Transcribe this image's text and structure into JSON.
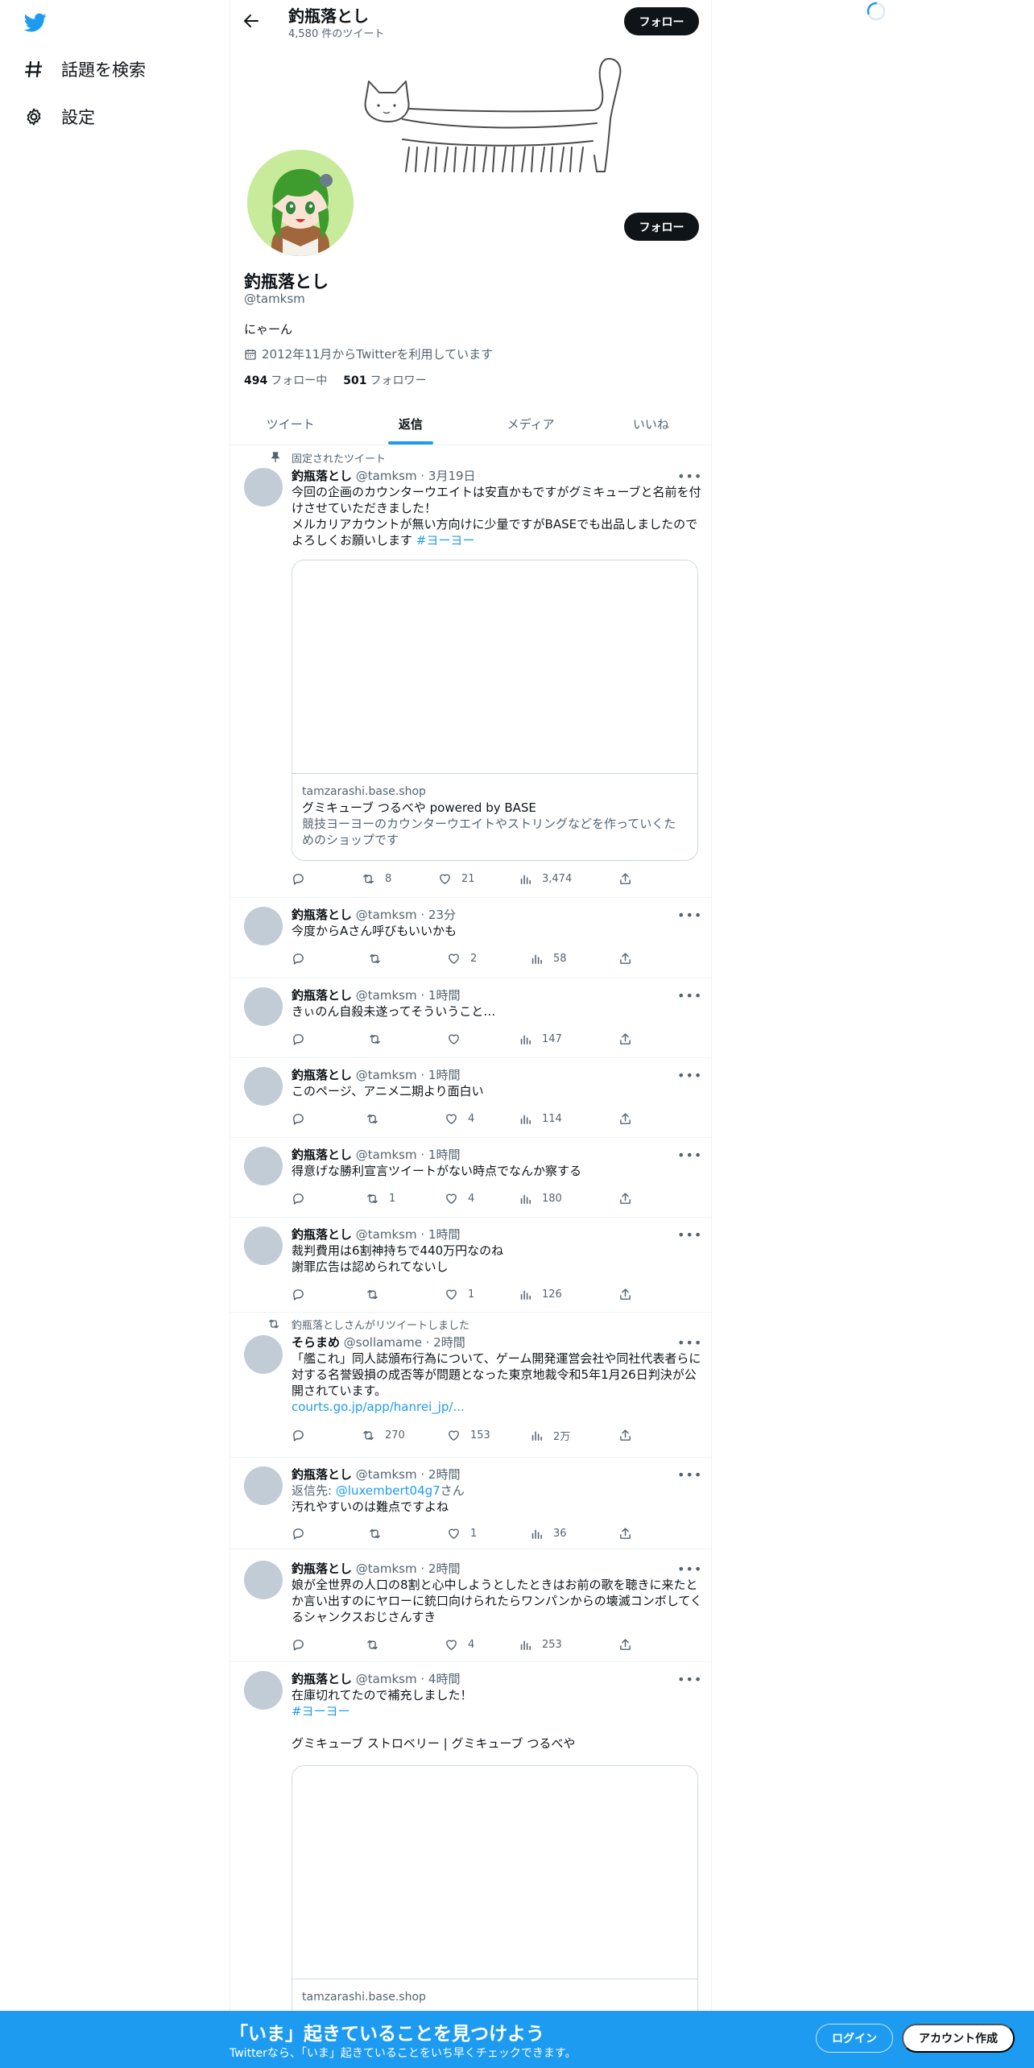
{
  "sidebar": {
    "logo": "twitter-bird-icon",
    "items": [
      {
        "label": "話題を検索",
        "icon": "hashtag-icon"
      },
      {
        "label": "設定",
        "icon": "gear-icon"
      }
    ]
  },
  "header": {
    "name": "釣瓶落とし",
    "tweet_count": "4,580 件のツイート",
    "follow_label": "フォロー"
  },
  "profile": {
    "follow_label": "フォロー",
    "name": "釣瓶落とし",
    "handle": "@tamksm",
    "bio": "にゃーん",
    "joined": "2012年11月からTwitterを利用しています",
    "following_count": "494",
    "following_label": "フォロー中",
    "followers_count": "501",
    "followers_label": "フォロワー"
  },
  "tabs": [
    {
      "label": "ツイート"
    },
    {
      "label": "返信",
      "active": true
    },
    {
      "label": "メディア"
    },
    {
      "label": "いいね"
    }
  ],
  "tweets": [
    {
      "pinned_label": "固定されたツイート",
      "name": "釣瓶落とし",
      "meta": "@tamksm · 3月19日",
      "text1": "今回の企画のカウンターウエイトは安直かもですがグミキューブと名前を付けさせていただきました！",
      "text2": "メルカリアカウントが無い方向けに少量ですがBASEでも出品しましたのでよろしくお願いします ",
      "hashtag": "#ヨーヨー",
      "card": {
        "domain": "tamzarashi.base.shop",
        "title": "グミキューブ つるべや powered by BASE",
        "desc": "競技ヨーヨーのカウンターウエイトやストリングなどを作っていくためのショップです"
      },
      "retweets": "8",
      "likes": "21",
      "views": "3,474"
    },
    {
      "name": "釣瓶落とし",
      "meta": "@tamksm · 23分",
      "text": "今度からAさん呼びもいいかも",
      "retweets": "",
      "likes": "2",
      "views": "58"
    },
    {
      "name": "釣瓶落とし",
      "meta": "@tamksm · 1時間",
      "text": "きぃのん自殺未遂ってそういうこと…",
      "retweets": "",
      "likes": "",
      "views": "147"
    },
    {
      "name": "釣瓶落とし",
      "meta": "@tamksm · 1時間",
      "text": "このページ、アニメ二期より面白い",
      "retweets": "",
      "likes": "4",
      "views": "114"
    },
    {
      "name": "釣瓶落とし",
      "meta": "@tamksm · 1時間",
      "text": "得意げな勝利宣言ツイートがない時点でなんか察する",
      "retweets": "1",
      "likes": "4",
      "views": "180"
    },
    {
      "name": "釣瓶落とし",
      "meta": "@tamksm · 1時間",
      "text1": "裁判費用は6割神持ちで440万円なのね",
      "text2": "謝罪広告は認められてないし",
      "retweets": "",
      "likes": "1",
      "views": "126"
    },
    {
      "retweet_context": "釣瓶落としさんがリツイートしました",
      "name": "そらまめ",
      "meta": "@sollamame · 2時間",
      "text": "「艦これ」同人誌頒布行為について、ゲーム開発運営会社や同社代表者らに対する名誉毀損の成否等が問題となった東京地裁令和5年1月26日判決が公開されています。",
      "link": "courts.go.jp/app/hanrei_jp/...",
      "retweets": "270",
      "likes": "153",
      "views": "2万"
    },
    {
      "name": "釣瓶落とし",
      "meta": "@tamksm · 2時間",
      "reply_prefix": "返信先: ",
      "reply_to": "@luxembert04g7",
      "reply_suffix": "さん",
      "text": "汚れやすいのは難点ですよね",
      "retweets": "",
      "likes": "1",
      "views": "36"
    },
    {
      "name": "釣瓶落とし",
      "meta": "@tamksm · 2時間",
      "text": "娘が全世界の人口の8割と心中しようとしたときはお前の歌を聴きに来たとか言い出すのにヤローに銃口向けられたらワンパンからの壊滅コンボしてくるシャンクスおじさんすき",
      "retweets": "",
      "likes": "4",
      "views": "253"
    },
    {
      "name": "釣瓶落とし",
      "meta": "@tamksm · 4時間",
      "text1": "在庫切れてたので補充しました！",
      "hashtag": "#ヨーヨー",
      "text2": "グミキューブ ストロベリー | グミキューブ つるべや",
      "card": {
        "domain": "tamzarashi.base.shop"
      }
    }
  ],
  "bottom_bar": {
    "title": "「いま」起きていることを見つけよう",
    "subtitle": "Twitterなら、「いま」起きていることをいち早くチェックできます。",
    "login_label": "ログイン",
    "signup_label": "アカウント作成"
  },
  "colors": {
    "accent": "#1d9bf0",
    "text": "#0f1419",
    "secondary": "#536471",
    "border": "#eff3f4"
  }
}
